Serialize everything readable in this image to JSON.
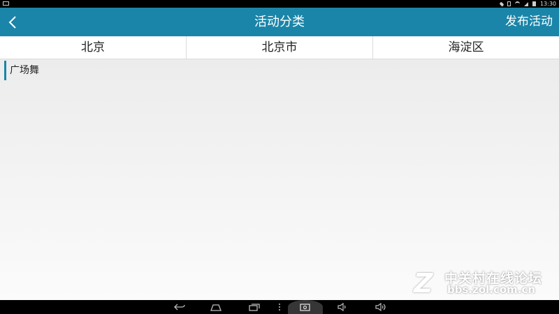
{
  "status_bar": {
    "time": "13:30"
  },
  "header": {
    "title": "活动分类",
    "publish_label": "发布活动",
    "background": "#1a85a8"
  },
  "tabs": [
    {
      "label": "北京"
    },
    {
      "label": "北京市"
    },
    {
      "label": "海淀区"
    }
  ],
  "categories": [
    {
      "label": "广场舞"
    }
  ],
  "watermark": {
    "brand": "中关村在线论坛",
    "url": "bbs.zol.com.cn"
  },
  "icons": {
    "back": "chevron-left-icon",
    "nav": [
      "back-icon",
      "home-icon",
      "recent-apps-icon",
      "menu-icon",
      "screenshot-icon",
      "volume-down-icon",
      "volume-up-icon"
    ]
  }
}
